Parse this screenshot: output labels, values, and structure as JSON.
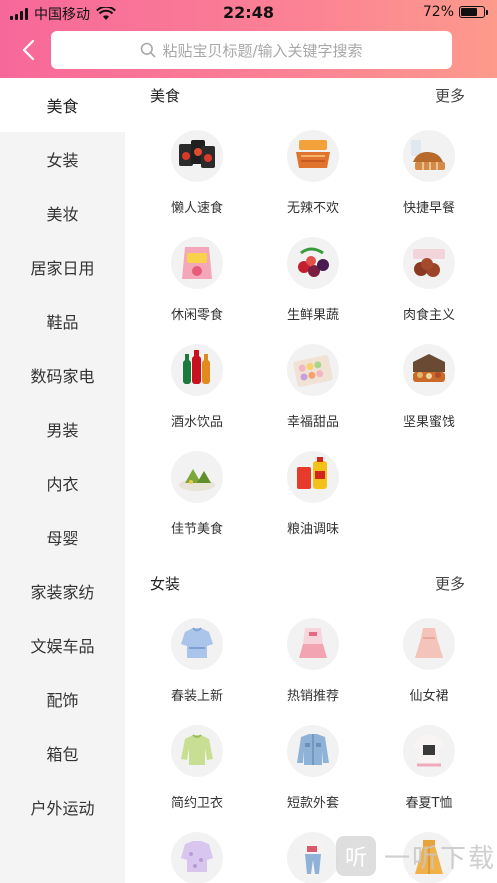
{
  "status_bar": {
    "carrier": "中国移动",
    "time": "22:48",
    "battery": "72%",
    "battery_level": 0.72
  },
  "search": {
    "placeholder": "粘贴宝贝标题/输入关键字搜索"
  },
  "sidebar": {
    "items": [
      {
        "label": "美食",
        "active": true
      },
      {
        "label": "女装"
      },
      {
        "label": "美妆"
      },
      {
        "label": "居家日用"
      },
      {
        "label": "鞋品"
      },
      {
        "label": "数码家电"
      },
      {
        "label": "男装"
      },
      {
        "label": "内衣"
      },
      {
        "label": "母婴"
      },
      {
        "label": "家装家纺"
      },
      {
        "label": "文娱车品"
      },
      {
        "label": "配饰"
      },
      {
        "label": "箱包"
      },
      {
        "label": "户外运动"
      }
    ]
  },
  "sections": [
    {
      "title": "美食",
      "more": "更多",
      "items": [
        {
          "label": "懒人速食",
          "icon": "instant-noodle-icon"
        },
        {
          "label": "无辣不欢",
          "icon": "spicy-meat-icon"
        },
        {
          "label": "快捷早餐",
          "icon": "bread-icon"
        },
        {
          "label": "休闲零食",
          "icon": "snack-bag-icon"
        },
        {
          "label": "生鲜果蔬",
          "icon": "fruit-icon"
        },
        {
          "label": "肉食主义",
          "icon": "meat-icon"
        },
        {
          "label": "酒水饮品",
          "icon": "drink-bottles-icon"
        },
        {
          "label": "幸福甜品",
          "icon": "macaron-icon"
        },
        {
          "label": "坚果蜜饯",
          "icon": "nut-box-icon"
        },
        {
          "label": "佳节美食",
          "icon": "rice-dumpling-icon"
        },
        {
          "label": "粮油调味",
          "icon": "oil-icon"
        }
      ]
    },
    {
      "title": "女装",
      "more": "更多",
      "items": [
        {
          "label": "春装上新",
          "icon": "blouse-icon"
        },
        {
          "label": "热销推荐",
          "icon": "dress-set-icon"
        },
        {
          "label": "仙女裙",
          "icon": "pink-dress-icon"
        },
        {
          "label": "简约卫衣",
          "icon": "sweatshirt-icon"
        },
        {
          "label": "短款外套",
          "icon": "denim-jacket-icon"
        },
        {
          "label": "春夏T恤",
          "icon": "tshirt-icon"
        },
        {
          "label": "",
          "icon": "lace-top-icon"
        },
        {
          "label": "",
          "icon": "outfit-icon"
        },
        {
          "label": "",
          "icon": "skirt-icon"
        }
      ]
    }
  ],
  "watermark": {
    "logo": "听",
    "text": "一听下载"
  }
}
